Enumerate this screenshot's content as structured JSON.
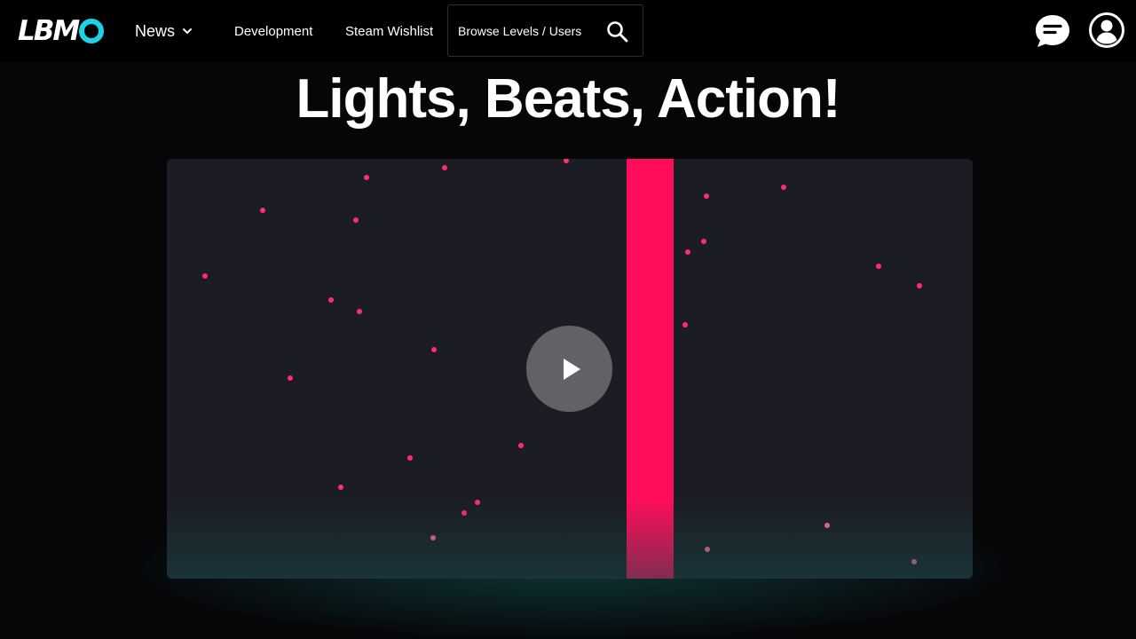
{
  "header": {
    "logo_text": "LBM",
    "nav": {
      "news_label": "News",
      "development_label": "Development",
      "steam_label": "Steam Wishlist"
    },
    "search": {
      "label": "Browse Levels / Users",
      "icon": "search-icon"
    },
    "icons": {
      "chat": "chat-icon",
      "user": "user-icon"
    }
  },
  "main": {
    "headline": "Lights, Beats, Action!"
  },
  "video": {
    "play_icon": "play-icon"
  },
  "colors": {
    "accent_cyan": "#19d3e6",
    "beam_pink": "#ff0d5a",
    "dot_pink": "#ff2d6e",
    "video_bg": "#1c1d24"
  }
}
